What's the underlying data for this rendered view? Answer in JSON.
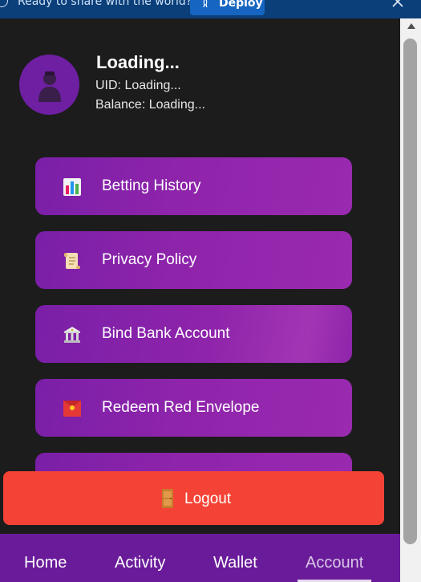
{
  "banner": {
    "text": "Ready to share with the world?",
    "deploy_label": "Deploy"
  },
  "profile": {
    "name": "Loading...",
    "uid": "UID: Loading...",
    "balance": "Balance: Loading..."
  },
  "menu": [
    {
      "label": "Betting History",
      "icon": "bar-chart-icon"
    },
    {
      "label": "Privacy Policy",
      "icon": "scroll-icon"
    },
    {
      "label": "Bind Bank Account",
      "icon": "bank-icon"
    },
    {
      "label": "Redeem Red Envelope",
      "icon": "red-envelope-icon"
    },
    {
      "label": "",
      "icon": ""
    }
  ],
  "logout": {
    "label": "Logout",
    "icon": "door-icon"
  },
  "nav": {
    "items": [
      "Home",
      "Activity",
      "Wallet",
      "Account"
    ],
    "active": "Account"
  },
  "colors": {
    "banner": "#0b3f7a",
    "background": "#1c1c1c",
    "card": "#8e24aa",
    "logout": "#f44336",
    "nav": "#6a1b9a"
  }
}
